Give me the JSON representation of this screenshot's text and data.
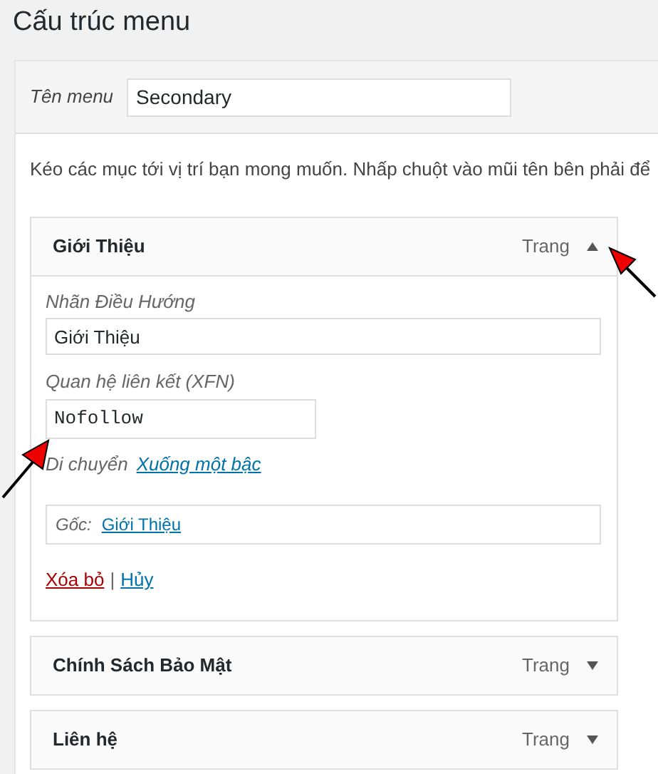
{
  "title": "Cấu trúc menu",
  "menu_name": {
    "label": "Tên menu",
    "value": "Secondary"
  },
  "instructions": "Kéo các mục tới vị trí bạn mong muốn. Nhấp chuột vào mũi tên bên phải để",
  "items": [
    {
      "title": "Giới Thiệu",
      "type": "Trang",
      "expanded": true,
      "nav_label": {
        "label": "Nhãn Điều Hướng",
        "value": "Giới Thiệu"
      },
      "xfn": {
        "label": "Quan hệ liên kết (XFN)",
        "value": "Nofollow"
      },
      "move": {
        "label": "Di chuyển",
        "link": "Xuống một bậc"
      },
      "original": {
        "label": "Gốc:",
        "link": "Giới Thiệu"
      },
      "remove": "Xóa bỏ",
      "separator": "|",
      "cancel": "Hủy"
    },
    {
      "title": "Chính Sách Bảo Mật",
      "type": "Trang",
      "expanded": false
    },
    {
      "title": "Liên hệ",
      "type": "Trang",
      "expanded": false
    }
  ]
}
